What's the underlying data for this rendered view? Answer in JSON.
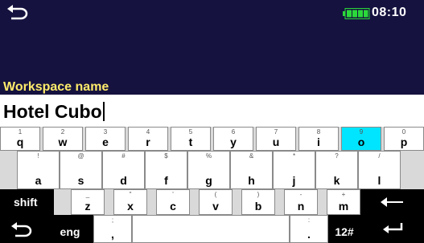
{
  "status_bar": {
    "time": "08:10",
    "battery_level_fraction": 1.0,
    "back_icon": "back-arrow-icon"
  },
  "form": {
    "label": "Workspace name",
    "value": "Hotel Cubo"
  },
  "keyboard": {
    "rows": [
      {
        "keys": [
          {
            "pri": "q",
            "sec": "1"
          },
          {
            "pri": "w",
            "sec": "2"
          },
          {
            "pri": "e",
            "sec": "3"
          },
          {
            "pri": "r",
            "sec": "4"
          },
          {
            "pri": "t",
            "sec": "5"
          },
          {
            "pri": "y",
            "sec": "6"
          },
          {
            "pri": "u",
            "sec": "7"
          },
          {
            "pri": "i",
            "sec": "8"
          },
          {
            "pri": "o",
            "sec": "9"
          },
          {
            "pri": "p",
            "sec": "0"
          }
        ]
      },
      {
        "keys": [
          {
            "pri": "a",
            "sec": "!"
          },
          {
            "pri": "s",
            "sec": "@"
          },
          {
            "pri": "d",
            "sec": "#"
          },
          {
            "pri": "f",
            "sec": "$"
          },
          {
            "pri": "g",
            "sec": "%"
          },
          {
            "pri": "h",
            "sec": "&"
          },
          {
            "pri": "j",
            "sec": "*"
          },
          {
            "pri": "k",
            "sec": "?"
          },
          {
            "pri": "l",
            "sec": "/"
          }
        ]
      },
      {
        "keys": [
          {
            "pri": "z",
            "sec": "_"
          },
          {
            "pri": "x",
            "sec": "\""
          },
          {
            "pri": "c",
            "sec": "'"
          },
          {
            "pri": "v",
            "sec": "("
          },
          {
            "pri": "b",
            "sec": ")"
          },
          {
            "pri": "n",
            "sec": "-"
          },
          {
            "pri": "m",
            "sec": "+"
          }
        ]
      },
      {
        "keys": [
          {
            "pri": ",",
            "sec": ";"
          },
          {
            "pri": ".",
            "sec": ":"
          }
        ]
      }
    ],
    "highlighted_key": "o",
    "shift_label": "shift",
    "lang_label": "eng",
    "numsym_label": "12#",
    "backspace_icon": "backspace-arrow-icon",
    "enter_icon": "enter-icon",
    "back_icon": "back-arrow-icon",
    "colors": {
      "highlight": "#00e5ff",
      "background": "#15123f",
      "label": "#ffeb6b"
    }
  }
}
